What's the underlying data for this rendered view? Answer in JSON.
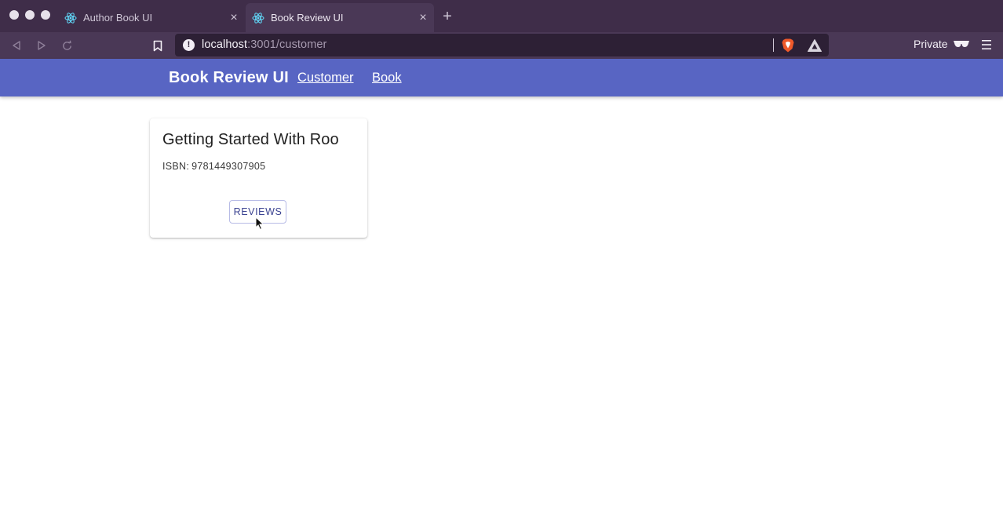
{
  "browser": {
    "tabs": [
      {
        "title": "Author Book UI",
        "icon": "react-icon",
        "active": false
      },
      {
        "title": "Book Review UI",
        "icon": "react-icon",
        "active": true
      }
    ],
    "url": {
      "host": "localhost",
      "path": ":3001/customer"
    },
    "private_label": "Private"
  },
  "app": {
    "title": "Book Review UI",
    "nav": [
      {
        "label": "Customer"
      },
      {
        "label": "Book"
      }
    ],
    "accent_color": "#5865c3"
  },
  "books": [
    {
      "title": "Getting Started With Roo",
      "isbn_label": "ISBN:",
      "isbn": "9781449307905",
      "button_label": "REVIEWS"
    }
  ]
}
